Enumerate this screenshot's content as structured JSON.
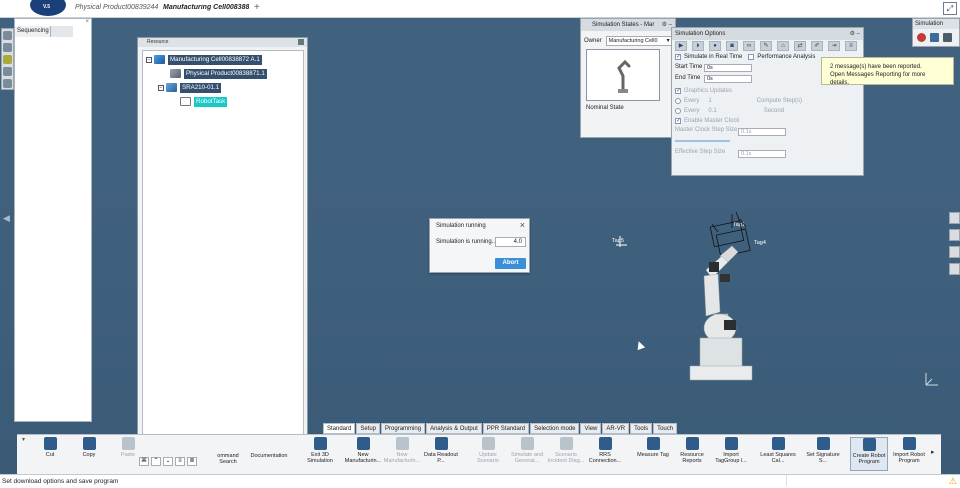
{
  "app": {
    "logo_text": "V.5",
    "tabs": [
      {
        "label": "Physical Product00839244"
      },
      {
        "label": "Manufacturing Cell00838872"
      }
    ],
    "add_tab": "+",
    "maximize": "⤢"
  },
  "sequencing": {
    "tab_label": "Sequencing",
    "close": "×"
  },
  "resource": {
    "title": "Resource",
    "tree": [
      {
        "label": "Manufacturing Cell00838872 A.1",
        "expander": "−",
        "icon": "manufacturing-cell-icon"
      },
      {
        "label": "Physical Product00838871.1",
        "expander": "",
        "icon": "product-icon"
      },
      {
        "label": "SRA210-01.1",
        "expander": "−",
        "icon": "robot-icon"
      },
      {
        "label": "RobotTask",
        "expander": "",
        "icon": "robot-task-icon"
      }
    ]
  },
  "sim_states": {
    "title": "Simulation States - Mar",
    "owner_label": "Owner",
    "owner_value": "Manufacturing Cell0",
    "state_label": "Nominal State"
  },
  "sim_options": {
    "title": "Simulation Options",
    "realtime_label": "Simulate in Real Time",
    "perf_label": "Performance Analysis",
    "start_label": "Start Time",
    "start_value": "0s",
    "end_label": "End Time",
    "end_value": "0s",
    "graphics_label": "Graphics Updates",
    "every_label": "Every",
    "every_value": "1",
    "every_unit": "Compute Step(s)",
    "every2_label": "Every",
    "every2_value": "0.1",
    "every2_unit": "Second",
    "master_clock_label": "Enable Master Clock",
    "master_step_label": "Master Clock Step Size",
    "master_step_value": "0.1s",
    "effective_label": "Effective Step Size",
    "effective_value": "0.1s"
  },
  "toast": {
    "line1": "2 message(s) have been reported.",
    "line2": "Open Messages Reporting for more details."
  },
  "sim_mini": {
    "title": "Simulation"
  },
  "run_dialog": {
    "title": "Simulation running",
    "label": "Simulation is running...",
    "value": "4.0",
    "abort": "Abort",
    "close": "×"
  },
  "scene": {
    "label_tag5": "Tag5",
    "label_tag1": "Tag1",
    "label_tag4": "Tag4"
  },
  "toolbar_tabs": [
    "Standard",
    "Setup",
    "Programming",
    "Analysis & Output",
    "PPR Standard",
    "Selection mode",
    "View",
    "AR-VR",
    "Tools",
    "Touch"
  ],
  "actions": [
    {
      "label": "Cut",
      "dim": false
    },
    {
      "label": "Copy",
      "dim": false
    },
    {
      "label": "Paste",
      "dim": true
    },
    {
      "label": "ommand Search",
      "dim": false
    },
    {
      "label": "Documentation",
      "dim": false
    },
    {
      "label": "Exit 3D Simulation",
      "dim": false
    },
    {
      "label": "New Manufacturin...",
      "dim": false
    },
    {
      "label": "New Manufacturin...",
      "dim": true
    },
    {
      "label": "Data Readout P...",
      "dim": false
    },
    {
      "label": "Update Scenario",
      "dim": true
    },
    {
      "label": "Simulate and Generat...",
      "dim": true
    },
    {
      "label": "Scenario Incident Diag...",
      "dim": true
    },
    {
      "label": "RRS Connection...",
      "dim": false
    },
    {
      "label": "Measure Tag",
      "dim": false
    },
    {
      "label": "Resource Reports",
      "dim": false
    },
    {
      "label": "Import TagGroup l...",
      "dim": false
    },
    {
      "label": "Least Squares Cal...",
      "dim": false
    },
    {
      "label": "Set Signature S...",
      "dim": false
    },
    {
      "label": "Create Robot Program",
      "dim": false
    },
    {
      "label": "Import Robot Program",
      "dim": false
    }
  ],
  "status": {
    "text": "Set download options and save program"
  }
}
